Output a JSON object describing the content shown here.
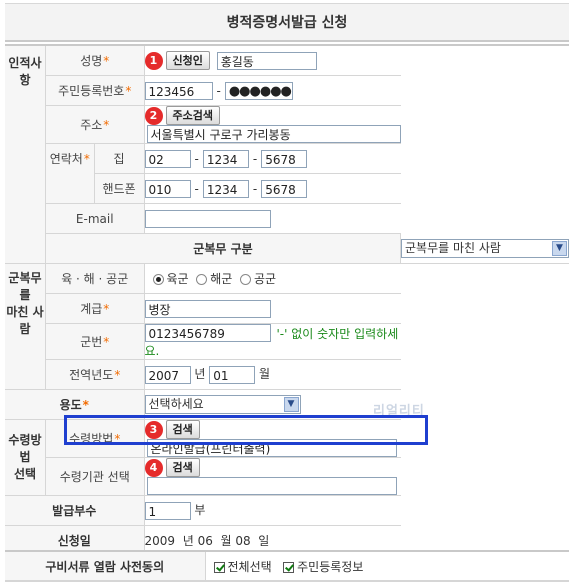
{
  "title": "병적증명서발급 신청",
  "personal": {
    "section": "인적사항",
    "name_label": "성명",
    "name_btn": "신청인",
    "name_value": "홍길동",
    "rrn_label": "주민등록번호",
    "rrn_first": "123456",
    "rrn_masked": "●●●●●●",
    "address_label": "주소",
    "address_btn": "주소검색",
    "address_value": "서울특별시 구로구 가리봉동",
    "contact_label": "연락처",
    "home_label": "집",
    "home": [
      "02",
      "1234",
      "5678"
    ],
    "mobile_label": "핸드폰",
    "mobile": [
      "010",
      "1234",
      "5678"
    ],
    "email_label": "E-mail",
    "email_value": ""
  },
  "service_type": {
    "label": "군복무 구분",
    "selected": "군복무를 마친 사람"
  },
  "completed": {
    "section_line1": "군복무를",
    "section_line2": "마친 사람",
    "branch_label": "육 · 해 · 공군",
    "branches": [
      "육군",
      "해군",
      "공군"
    ],
    "branch_selected": 0,
    "rank_label": "계급",
    "rank_value": "병장",
    "serial_label": "군번",
    "serial_value": "0123456789",
    "serial_note": "'-' 없이 숫자만 입력하세요.",
    "discharge_label": "전역년도",
    "discharge_year": "2007",
    "year_unit": "년",
    "discharge_month": "01",
    "month_unit": "월"
  },
  "purpose": {
    "label": "용도",
    "selected": "선택하세요"
  },
  "receive": {
    "section_line1": "수령방법",
    "section_line2": "선택",
    "method_label": "수령방법",
    "method_btn": "검색",
    "method_value": "온라인발급(프린터출력)",
    "org_label": "수령기관 선택",
    "org_btn": "검색",
    "org_value": ""
  },
  "copies": {
    "label": "발급부수",
    "value": "1",
    "unit": "부"
  },
  "date": {
    "label": "신청일",
    "year": "2009",
    "year_unit": "년",
    "month": "06",
    "month_unit": "월",
    "day": "08",
    "day_unit": "일"
  },
  "consent": {
    "label": "구비서류 열람 사전동의",
    "all": "전체선택",
    "rrn": "주민등록정보"
  },
  "watermark": "리얼리티",
  "badges": [
    "1",
    "2",
    "3",
    "4"
  ],
  "colors": {
    "badge": "#e52b2b",
    "highlight": "#1f3fcf",
    "required": "#f26b00",
    "note": "#1b8a1b"
  }
}
